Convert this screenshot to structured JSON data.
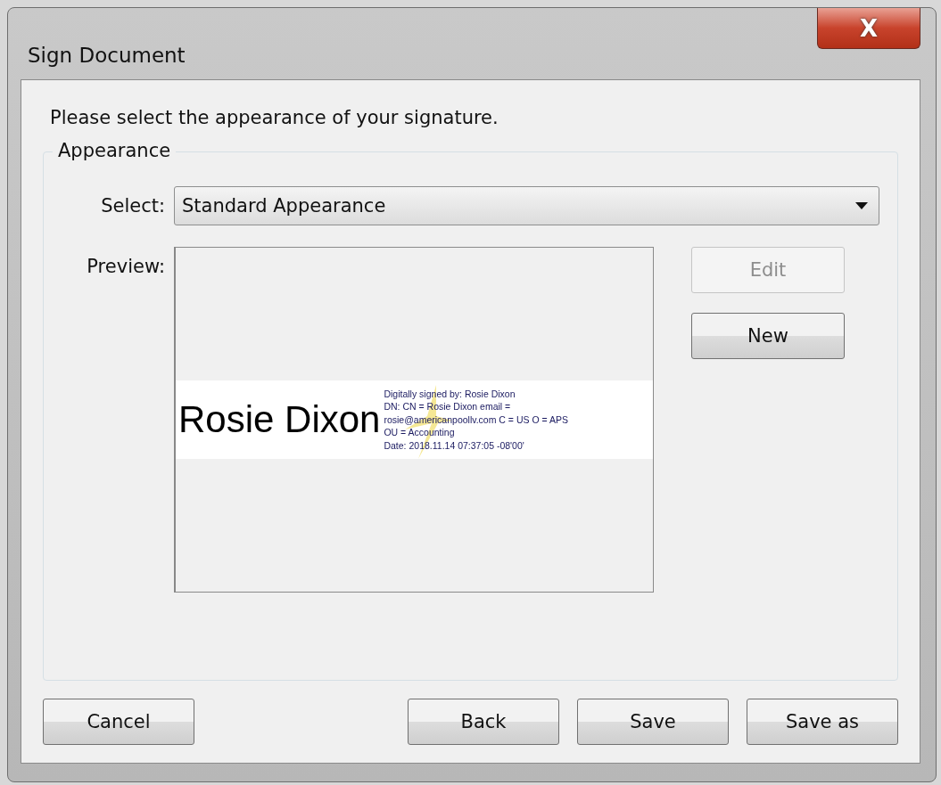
{
  "window": {
    "title": "Sign Document",
    "close_label": "X"
  },
  "instruction": "Please select the appearance of your signature.",
  "appearance": {
    "legend": "Appearance",
    "select_label": "Select:",
    "select_value": "Standard Appearance",
    "preview_label": "Preview:",
    "signature": {
      "name": "Rosie Dixon",
      "details": [
        "Digitally signed by: Rosie Dixon",
        "DN: CN = Rosie Dixon email =",
        "rosie@americanpoollv.com C = US O = APS",
        "OU = Accounting",
        "Date: 2018.11.14 07:37:05 -08'00'"
      ]
    },
    "side_buttons": [
      {
        "label": "Edit",
        "disabled": true
      },
      {
        "label": "New",
        "disabled": false
      }
    ]
  },
  "footer_buttons": [
    {
      "label": "Cancel",
      "disabled": false
    },
    {
      "label": "Back",
      "disabled": false
    },
    {
      "label": "Save",
      "disabled": false
    },
    {
      "label": "Save as",
      "disabled": false
    }
  ]
}
